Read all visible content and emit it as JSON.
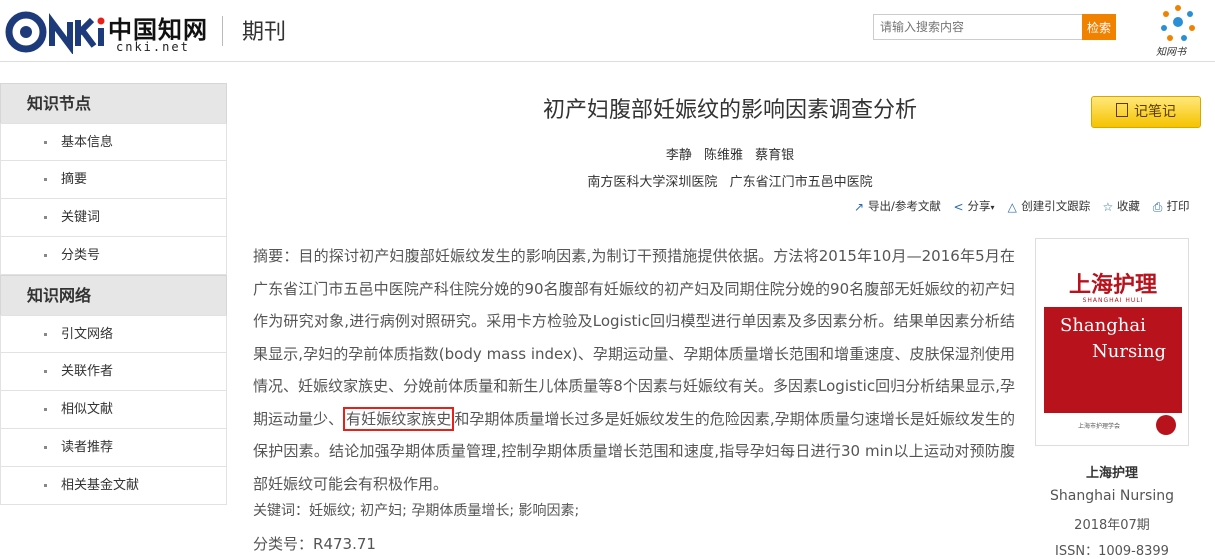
{
  "header": {
    "logo_latin": "CNKi",
    "logo_cn": "中国知网",
    "logo_domain": "cnki.net",
    "section": "期刊",
    "search_placeholder": "请输入搜索内容",
    "search_button": "检索",
    "partner_logo_text": "知网书"
  },
  "sidebar": {
    "groups": [
      {
        "title": "知识节点",
        "items": [
          "基本信息",
          "摘要",
          "关键词",
          "分类号"
        ]
      },
      {
        "title": "知识网络",
        "items": [
          "引文网络",
          "关联作者",
          "相似文献",
          "读者推荐",
          "相关基金文献"
        ]
      }
    ]
  },
  "article": {
    "title": "初产妇腹部妊娠纹的影响因素调查分析",
    "note_button": "记笔记",
    "authors": [
      "李静",
      "陈维雅",
      "蔡育银"
    ],
    "affiliations": [
      "南方医科大学深圳医院",
      "广东省江门市五邑中医院"
    ],
    "tools": [
      "导出/参考文献",
      "分享",
      "创建引文跟踪",
      "收藏",
      "打印"
    ],
    "abstract_label": "摘要：",
    "abstract_before": "目的探讨初产妇腹部妊娠纹发生的影响因素,为制订干预措施提供依据。方法将2015年10月—2016年5月在广东省江门市五邑中医院产科住院分娩的90名腹部有妊娠纹的初产妇及同期住院分娩的90名腹部无妊娠纹的初产妇作为研究对象,进行病例对照研究。采用卡方检验及Logistic回归模型进行单因素及多因素分析。结果单因素分析结果显示,孕妇的孕前体质指数(body mass index)、孕期运动量、孕期体质量增长范围和增重速度、皮肤保湿剂使用情况、妊娠纹家族史、分娩前体质量和新生儿体质量等8个因素与妊娠纹有关。多因素Logistic回归分析结果显示,孕期运动量少、",
    "abstract_highlight": "有妊娠纹家族史",
    "abstract_after": "和孕期体质量增长过多是妊娠纹发生的危险因素,孕期体质量匀速增长是妊娠纹发生的保护因素。结论加强孕期体质量管理,控制孕期体质量增长范围和速度,指导孕妇每日进行30 min以上运动对预防腹部妊娠纹可能会有积极作用。",
    "keywords_label": "关键词：",
    "keywords": "妊娠纹; 初产妇; 孕期体质量增长; 影响因素;",
    "class_label": "分类号：",
    "class_no": "R473.71"
  },
  "journal": {
    "cover_cn": "上海护理",
    "cover_sub": "SHANGHAI HULI",
    "cover_en_1": "Shanghai",
    "cover_en_2": "Nursing",
    "cover_publisher": "上海市护理学会",
    "name_cn": "上海护理",
    "name_en": "Shanghai Nursing",
    "issue": "2018年07期",
    "issn": "ISSN：1009-8399"
  },
  "colors": {
    "search_button": "#f08200",
    "note_button": "#f5c300",
    "highlight_border": "#e8201a",
    "cover_red": "#b8131c",
    "logo_blue": "#1d3b7a"
  }
}
